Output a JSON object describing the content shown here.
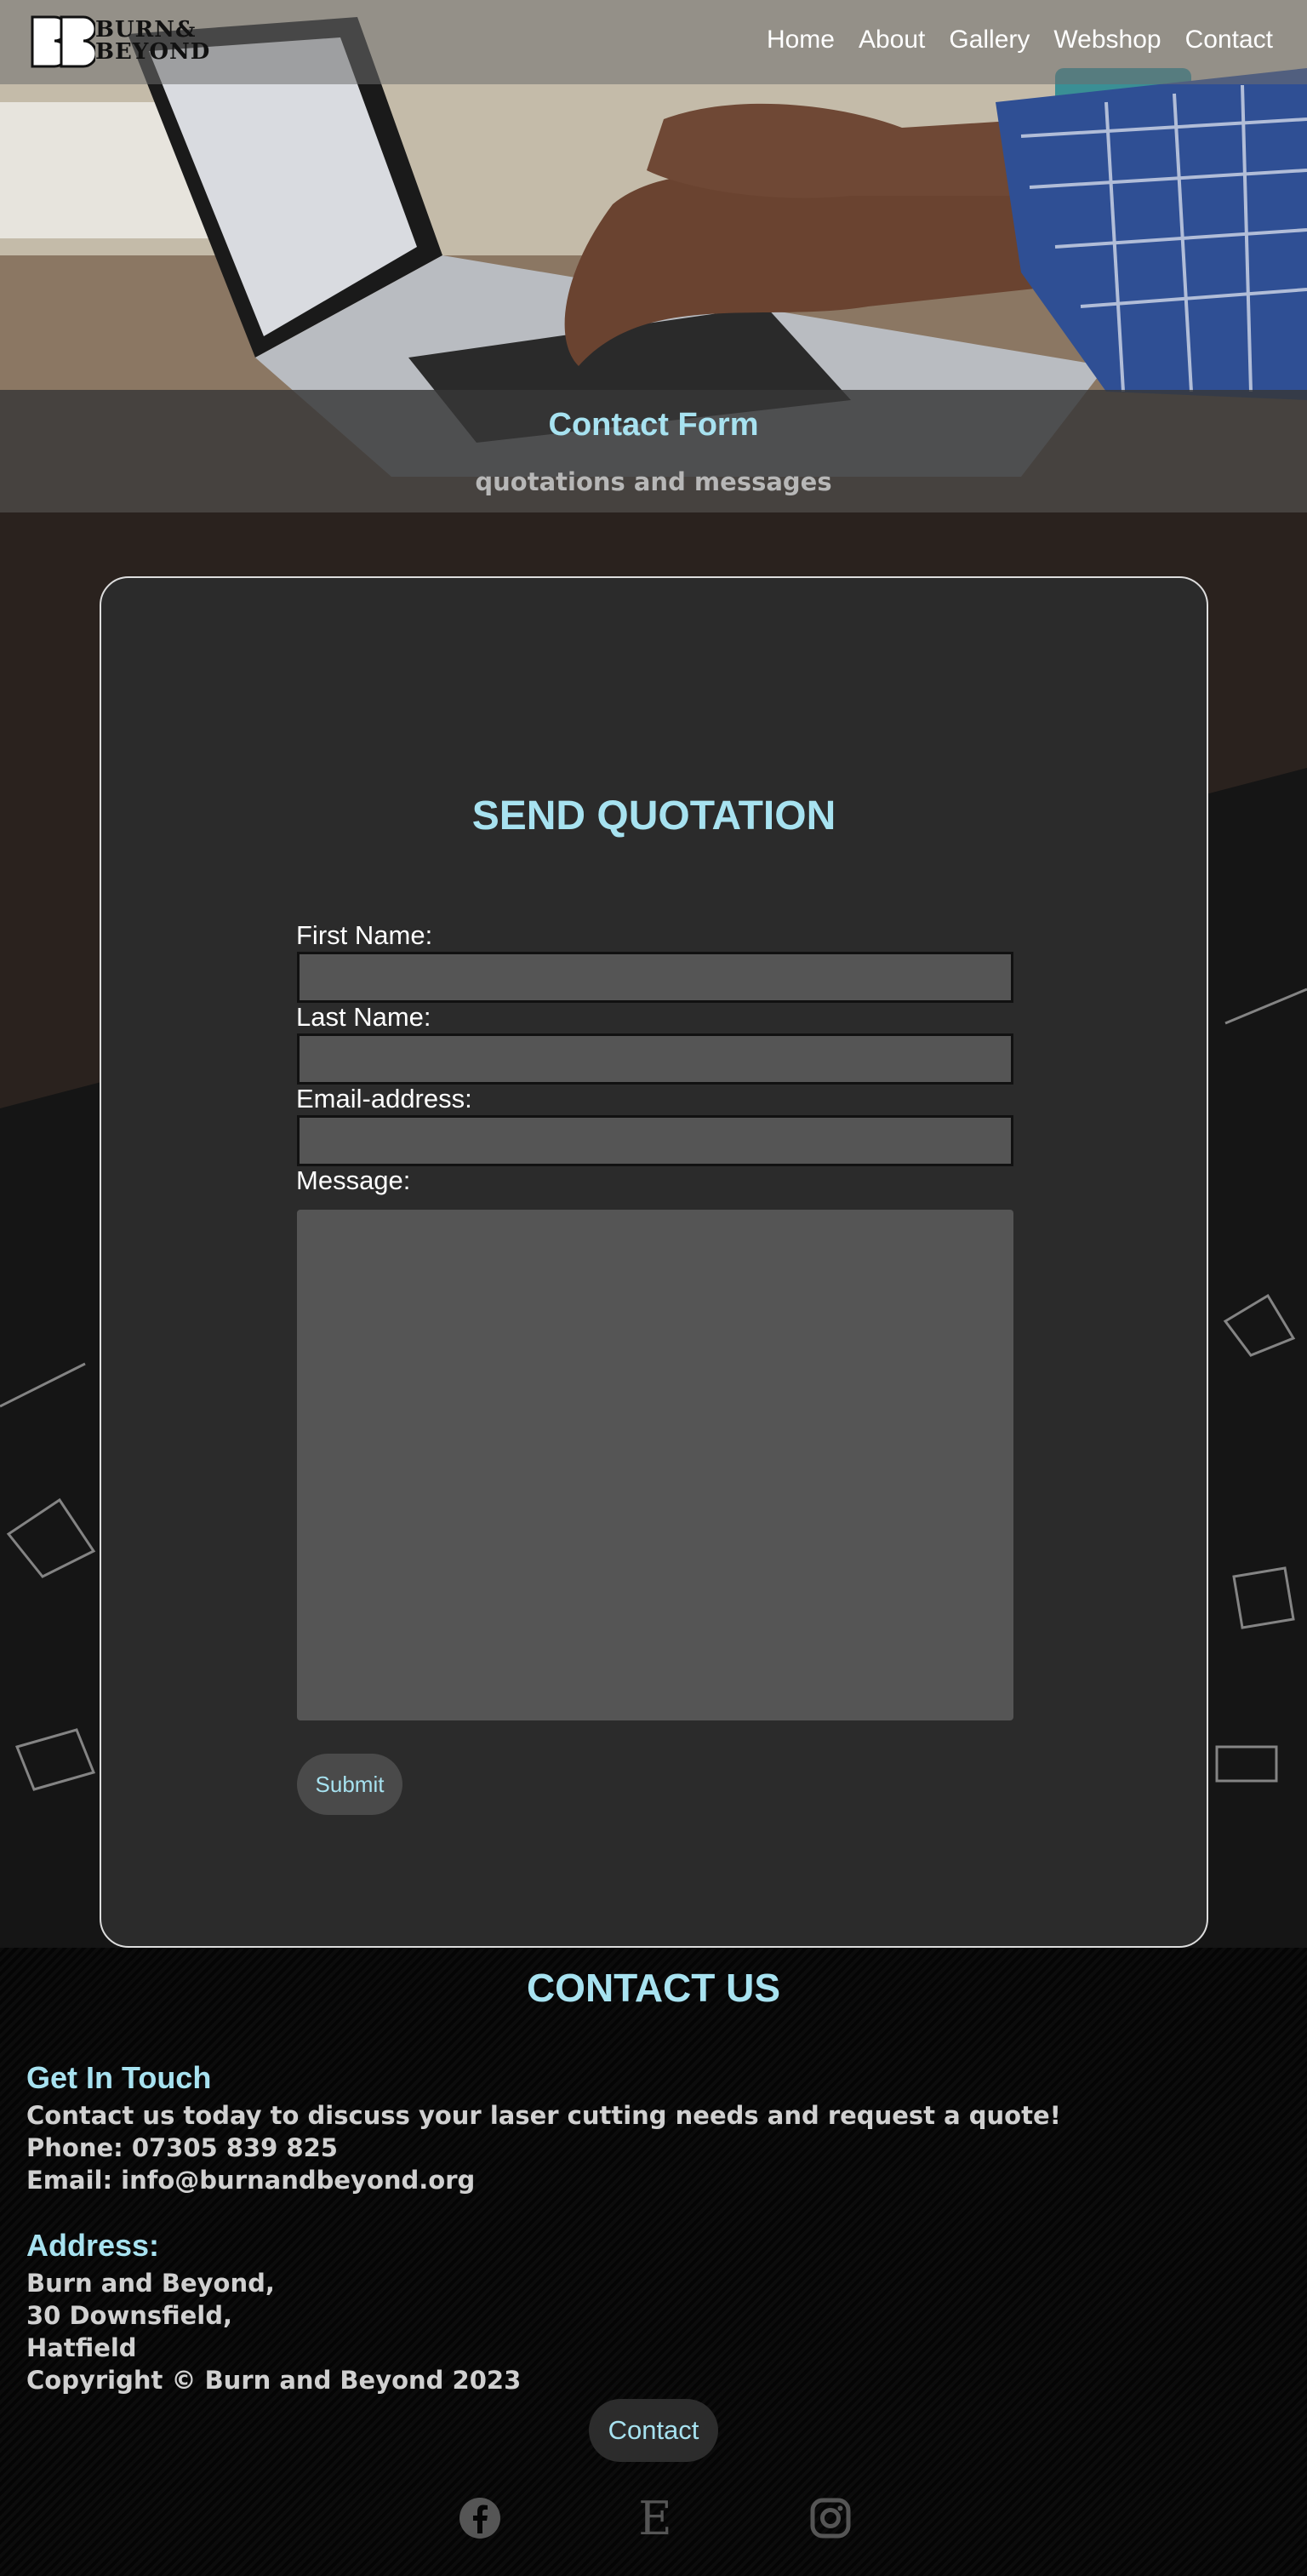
{
  "brand": {
    "logo_mark": "BB",
    "name_line1": "BURN&",
    "name_line2": "BEYOND"
  },
  "nav": {
    "items": [
      "Home",
      "About",
      "Gallery",
      "Webshop",
      "Contact"
    ]
  },
  "banner": {
    "title": "Contact Form",
    "subtitle": "quotations and messages"
  },
  "form": {
    "heading": "SEND QUOTATION",
    "first_name_label": "First Name:",
    "last_name_label": "Last Name:",
    "email_label": "Email-address:",
    "message_label": "Message:",
    "first_name_value": "",
    "last_name_value": "",
    "email_value": "",
    "message_value": "",
    "submit_label": "Submit"
  },
  "footer": {
    "heading": "CONTACT US",
    "get_in_touch_title": "Get In Touch",
    "intro": "Contact us today to discuss your laser cutting needs and request a quote!",
    "phone": "Phone: 07305 839 825",
    "email": "Email: info@burnandbeyond.org",
    "address_title": "Address:",
    "address_lines": [
      "Burn and Beyond,",
      "30 Downsfield,",
      "Hatfield"
    ],
    "copyright": "Copyright © Burn and Beyond 2023",
    "contact_button": "Contact",
    "social_icons": [
      "facebook-icon",
      "etsy-icon",
      "instagram-icon"
    ]
  },
  "colors": {
    "accent": "#a7e2f0",
    "card": "#2b2b2b",
    "input": "#555555"
  }
}
